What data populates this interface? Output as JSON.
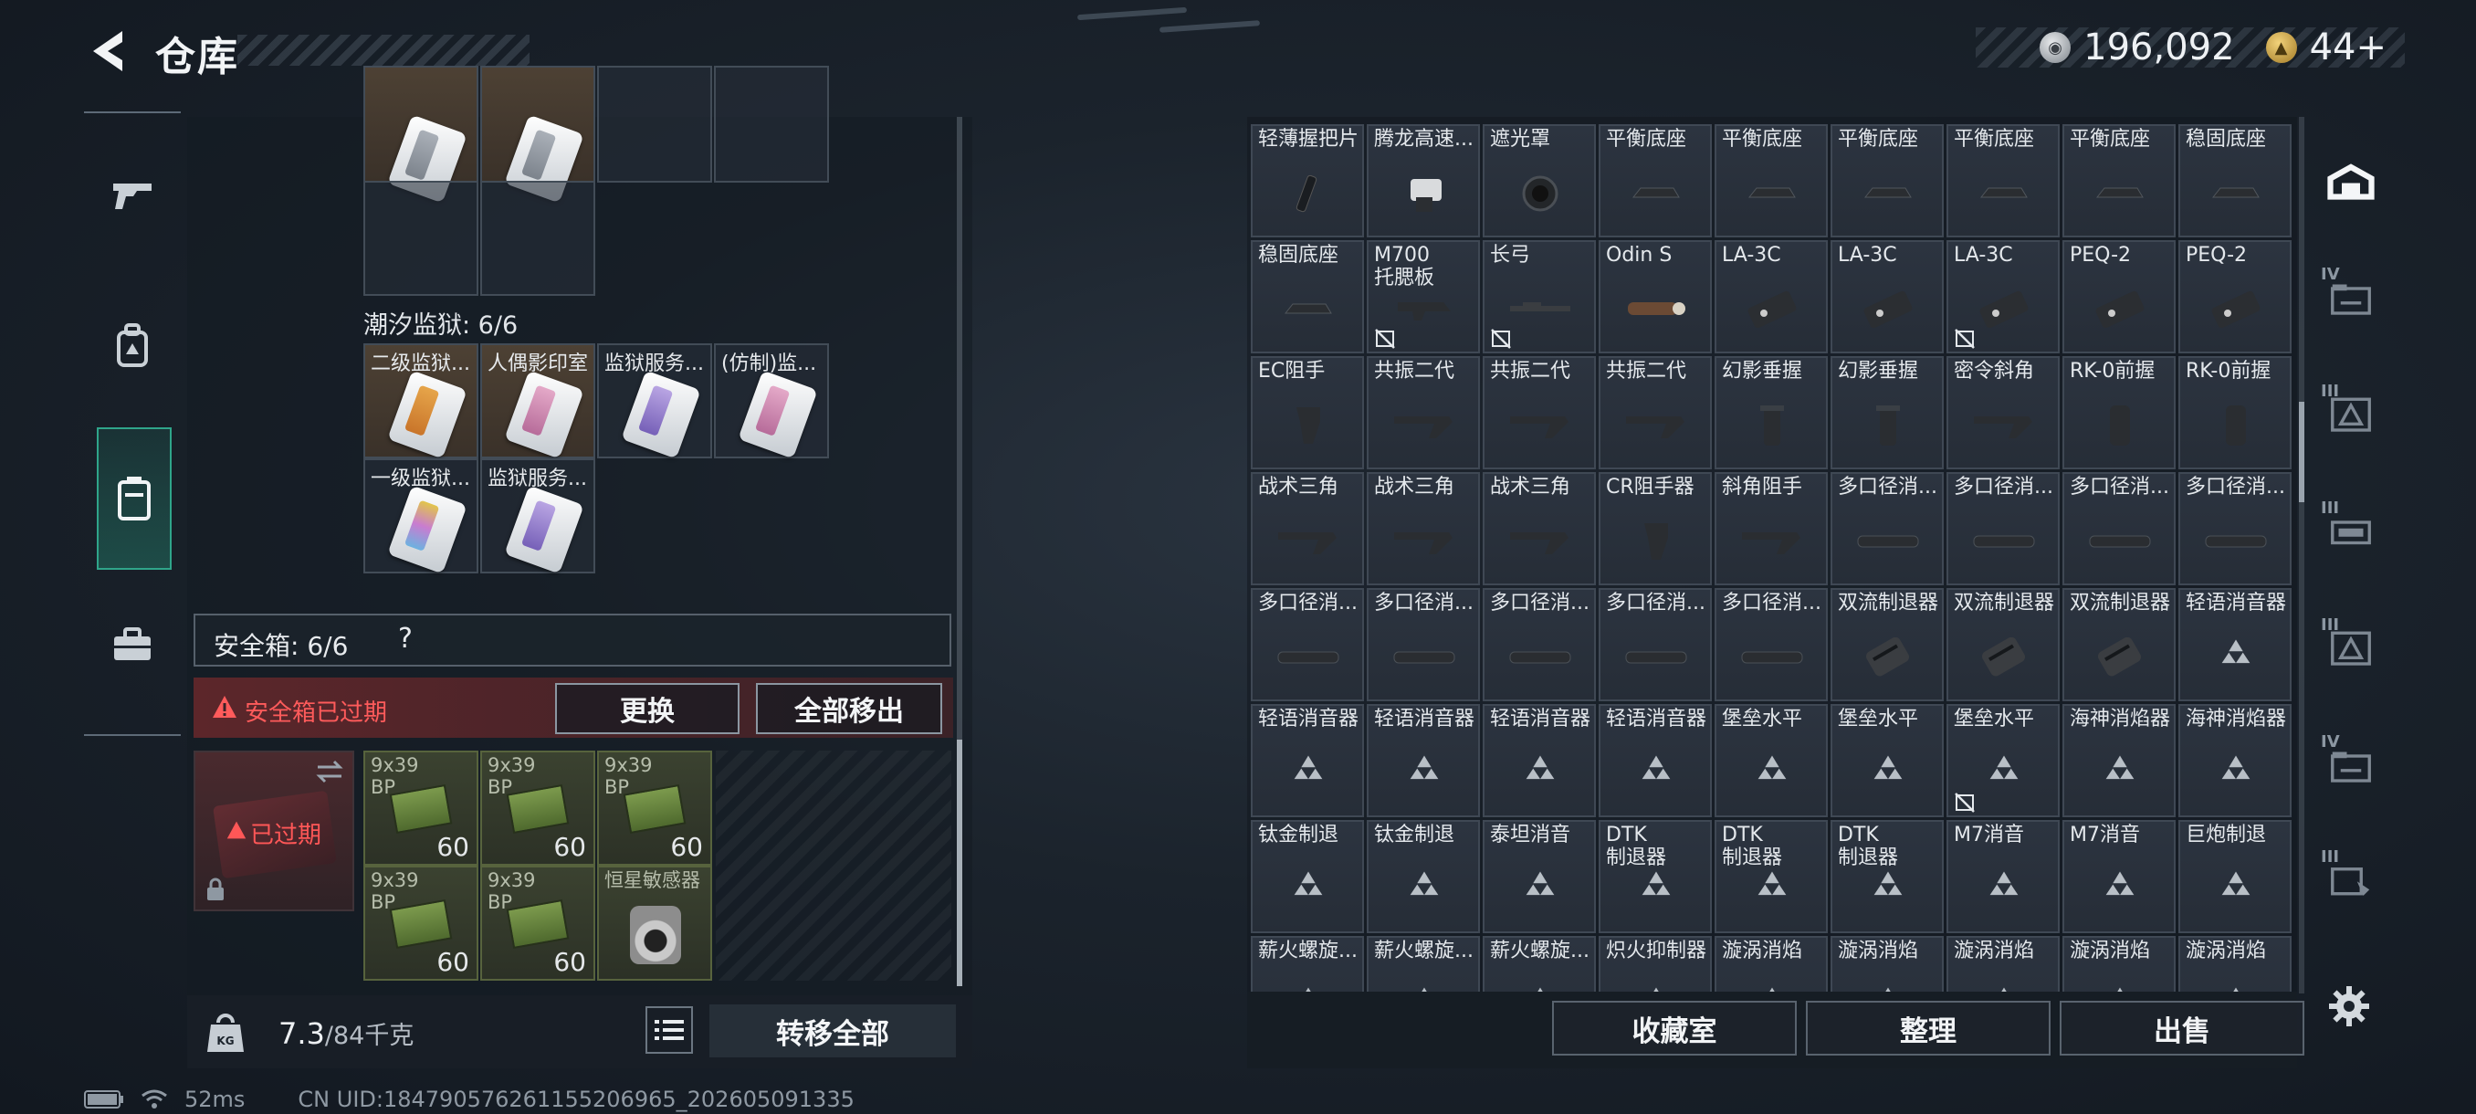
{
  "header": {
    "title": "仓库",
    "currencies": [
      {
        "icon": "silver-coin-icon",
        "value": "196,092"
      },
      {
        "icon": "gold-coin-icon",
        "value": "44+"
      }
    ]
  },
  "left_rail": {
    "items": [
      {
        "icon": "weapon-icon",
        "active": false
      },
      {
        "icon": "backpack-icon",
        "active": false
      },
      {
        "icon": "container-icon",
        "active": true
      },
      {
        "icon": "toolbox-icon",
        "active": false
      }
    ]
  },
  "left_panel": {
    "top_grid_placeholder_cards": 2,
    "section_title": "潮汐监狱: 6/6",
    "keycards": [
      {
        "name": "二级监狱...",
        "color": "orange",
        "bg": "brown"
      },
      {
        "name": "人偶影印室",
        "color": "pink",
        "bg": "brown"
      },
      {
        "name": "监狱服务...",
        "color": "purple",
        "bg": "grey"
      },
      {
        "name": "(仿制)监...",
        "color": "pink",
        "bg": "grey"
      },
      {
        "name": "一级监狱...",
        "color": "rainbow",
        "bg": "grey"
      },
      {
        "name": "监狱服务...",
        "color": "purple",
        "bg": "grey"
      }
    ],
    "safe_box": {
      "label": "安全箱:  6/6",
      "help": "?",
      "expired_warning": "安全箱已过期",
      "replace_button": "更换",
      "move_all_button": "全部移出",
      "slot_status": "已过期"
    },
    "safe_items": [
      {
        "name": "9x39\nBP",
        "count": "60",
        "type": "ammo"
      },
      {
        "name": "9x39\nBP",
        "count": "60",
        "type": "ammo"
      },
      {
        "name": "9x39\nBP",
        "count": "60",
        "type": "ammo"
      },
      {
        "name": "9x39\nBP",
        "count": "60",
        "type": "ammo"
      },
      {
        "name": "9x39\nBP",
        "count": "60",
        "type": "ammo"
      },
      {
        "name": "恒星敏感器",
        "count": "",
        "type": "sensor"
      }
    ],
    "weight": {
      "current": "7.3",
      "max": "/84千克"
    },
    "transfer_all_button": "转移全部"
  },
  "status_line": {
    "ping": "52ms",
    "uid": "CN UID:1847905762611552069​65_202605091335"
  },
  "right_panel": {
    "items": [
      {
        "name": "轻薄握把片",
        "gfx": "grip-plate"
      },
      {
        "name": "腾龙高速...",
        "gfx": "mount"
      },
      {
        "name": "遮光罩",
        "gfx": "hood"
      },
      {
        "name": "平衡底座",
        "gfx": "base"
      },
      {
        "name": "平衡底座",
        "gfx": "base"
      },
      {
        "name": "平衡底座",
        "gfx": "base"
      },
      {
        "name": "平衡底座",
        "gfx": "base"
      },
      {
        "name": "平衡底座",
        "gfx": "base"
      },
      {
        "name": "稳固底座",
        "gfx": "base"
      },
      {
        "name": "稳固底座",
        "gfx": "base"
      },
      {
        "name": "M700\n托腮板",
        "gfx": "cheek",
        "tag": true
      },
      {
        "name": "长弓",
        "gfx": "rail",
        "tag": true
      },
      {
        "name": "Odin S",
        "gfx": "light"
      },
      {
        "name": "LA-3C",
        "gfx": "laser"
      },
      {
        "name": "LA-3C",
        "gfx": "laser"
      },
      {
        "name": "LA-3C",
        "gfx": "laser",
        "tag": true
      },
      {
        "name": "PEQ-2",
        "gfx": "laser"
      },
      {
        "name": "PEQ-2",
        "gfx": "laser"
      },
      {
        "name": "EC阻手",
        "gfx": "handstop"
      },
      {
        "name": "共振二代",
        "gfx": "angled"
      },
      {
        "name": "共振二代",
        "gfx": "angled"
      },
      {
        "name": "共振二代",
        "gfx": "angled"
      },
      {
        "name": "幻影垂握",
        "gfx": "vgrip"
      },
      {
        "name": "幻影垂握",
        "gfx": "vgrip"
      },
      {
        "name": "密令斜角",
        "gfx": "angled"
      },
      {
        "name": "RK-0前握",
        "gfx": "vgrip2"
      },
      {
        "name": "RK-0前握",
        "gfx": "vgrip2"
      },
      {
        "name": "战术三角",
        "gfx": "angled"
      },
      {
        "name": "战术三角",
        "gfx": "angled"
      },
      {
        "name": "战术三角",
        "gfx": "angled"
      },
      {
        "name": "CR阻手器",
        "gfx": "handstop"
      },
      {
        "name": "斜角阻手",
        "gfx": "angled"
      },
      {
        "name": "多口径消...",
        "gfx": "suppressor"
      },
      {
        "name": "多口径消...",
        "gfx": "suppressor"
      },
      {
        "name": "多口径消...",
        "gfx": "suppressor"
      },
      {
        "name": "多口径消...",
        "gfx": "suppressor"
      },
      {
        "name": "多口径消...",
        "gfx": "suppressor"
      },
      {
        "name": "多口径消...",
        "gfx": "suppressor"
      },
      {
        "name": "多口径消...",
        "gfx": "suppressor"
      },
      {
        "name": "多口径消...",
        "gfx": "suppressor"
      },
      {
        "name": "多口径消...",
        "gfx": "suppressor"
      },
      {
        "name": "双流制退器",
        "gfx": "brake"
      },
      {
        "name": "双流制退器",
        "gfx": "brake"
      },
      {
        "name": "双流制退器",
        "gfx": "brake"
      },
      {
        "name": "轻语消音器",
        "gfx": "unknown"
      },
      {
        "name": "轻语消音器",
        "gfx": "unknown"
      },
      {
        "name": "轻语消音器",
        "gfx": "unknown"
      },
      {
        "name": "轻语消音器",
        "gfx": "unknown"
      },
      {
        "name": "轻语消音器",
        "gfx": "unknown"
      },
      {
        "name": "堡垒水平",
        "gfx": "unknown"
      },
      {
        "name": "堡垒水平",
        "gfx": "unknown"
      },
      {
        "name": "堡垒水平",
        "gfx": "unknown",
        "tag": true
      },
      {
        "name": "海神消焰器",
        "gfx": "unknown"
      },
      {
        "name": "海神消焰器",
        "gfx": "unknown"
      },
      {
        "name": "钛金制退",
        "gfx": "unknown"
      },
      {
        "name": "钛金制退",
        "gfx": "unknown"
      },
      {
        "name": "泰坦消音",
        "gfx": "unknown"
      },
      {
        "name": "DTK\n制退器",
        "gfx": "unknown"
      },
      {
        "name": "DTK\n制退器",
        "gfx": "unknown"
      },
      {
        "name": "DTK\n制退器",
        "gfx": "unknown"
      },
      {
        "name": "M7消音",
        "gfx": "unknown"
      },
      {
        "name": "M7消音",
        "gfx": "unknown"
      },
      {
        "name": "巨炮制退",
        "gfx": "unknown"
      },
      {
        "name": "薪火螺旋...",
        "gfx": "unknown"
      },
      {
        "name": "薪火螺旋...",
        "gfx": "unknown"
      },
      {
        "name": "薪火螺旋...",
        "gfx": "unknown"
      },
      {
        "name": "炽火抑制器",
        "gfx": "unknown"
      },
      {
        "name": "漩涡消焰",
        "gfx": "unknown"
      },
      {
        "name": "漩涡消焰",
        "gfx": "unknown"
      },
      {
        "name": "漩涡消焰",
        "gfx": "unknown"
      },
      {
        "name": "漩涡消焰",
        "gfx": "unknown"
      },
      {
        "name": "漩涡消焰",
        "gfx": "unknown"
      }
    ],
    "actions": {
      "collection": "收藏室",
      "organize": "整理",
      "sell": "出售"
    }
  },
  "right_rail": {
    "items": [
      {
        "icon": "home-base-icon",
        "tier": ""
      },
      {
        "icon": "folder-icon",
        "tier": "IV"
      },
      {
        "icon": "triangle-box-icon",
        "tier": "III"
      },
      {
        "icon": "equipment-icon",
        "tier": "III"
      },
      {
        "icon": "triangle-box-icon",
        "tier": "III"
      },
      {
        "icon": "folder-icon",
        "tier": "IV"
      },
      {
        "icon": "card-icon",
        "tier": "III"
      }
    ]
  }
}
